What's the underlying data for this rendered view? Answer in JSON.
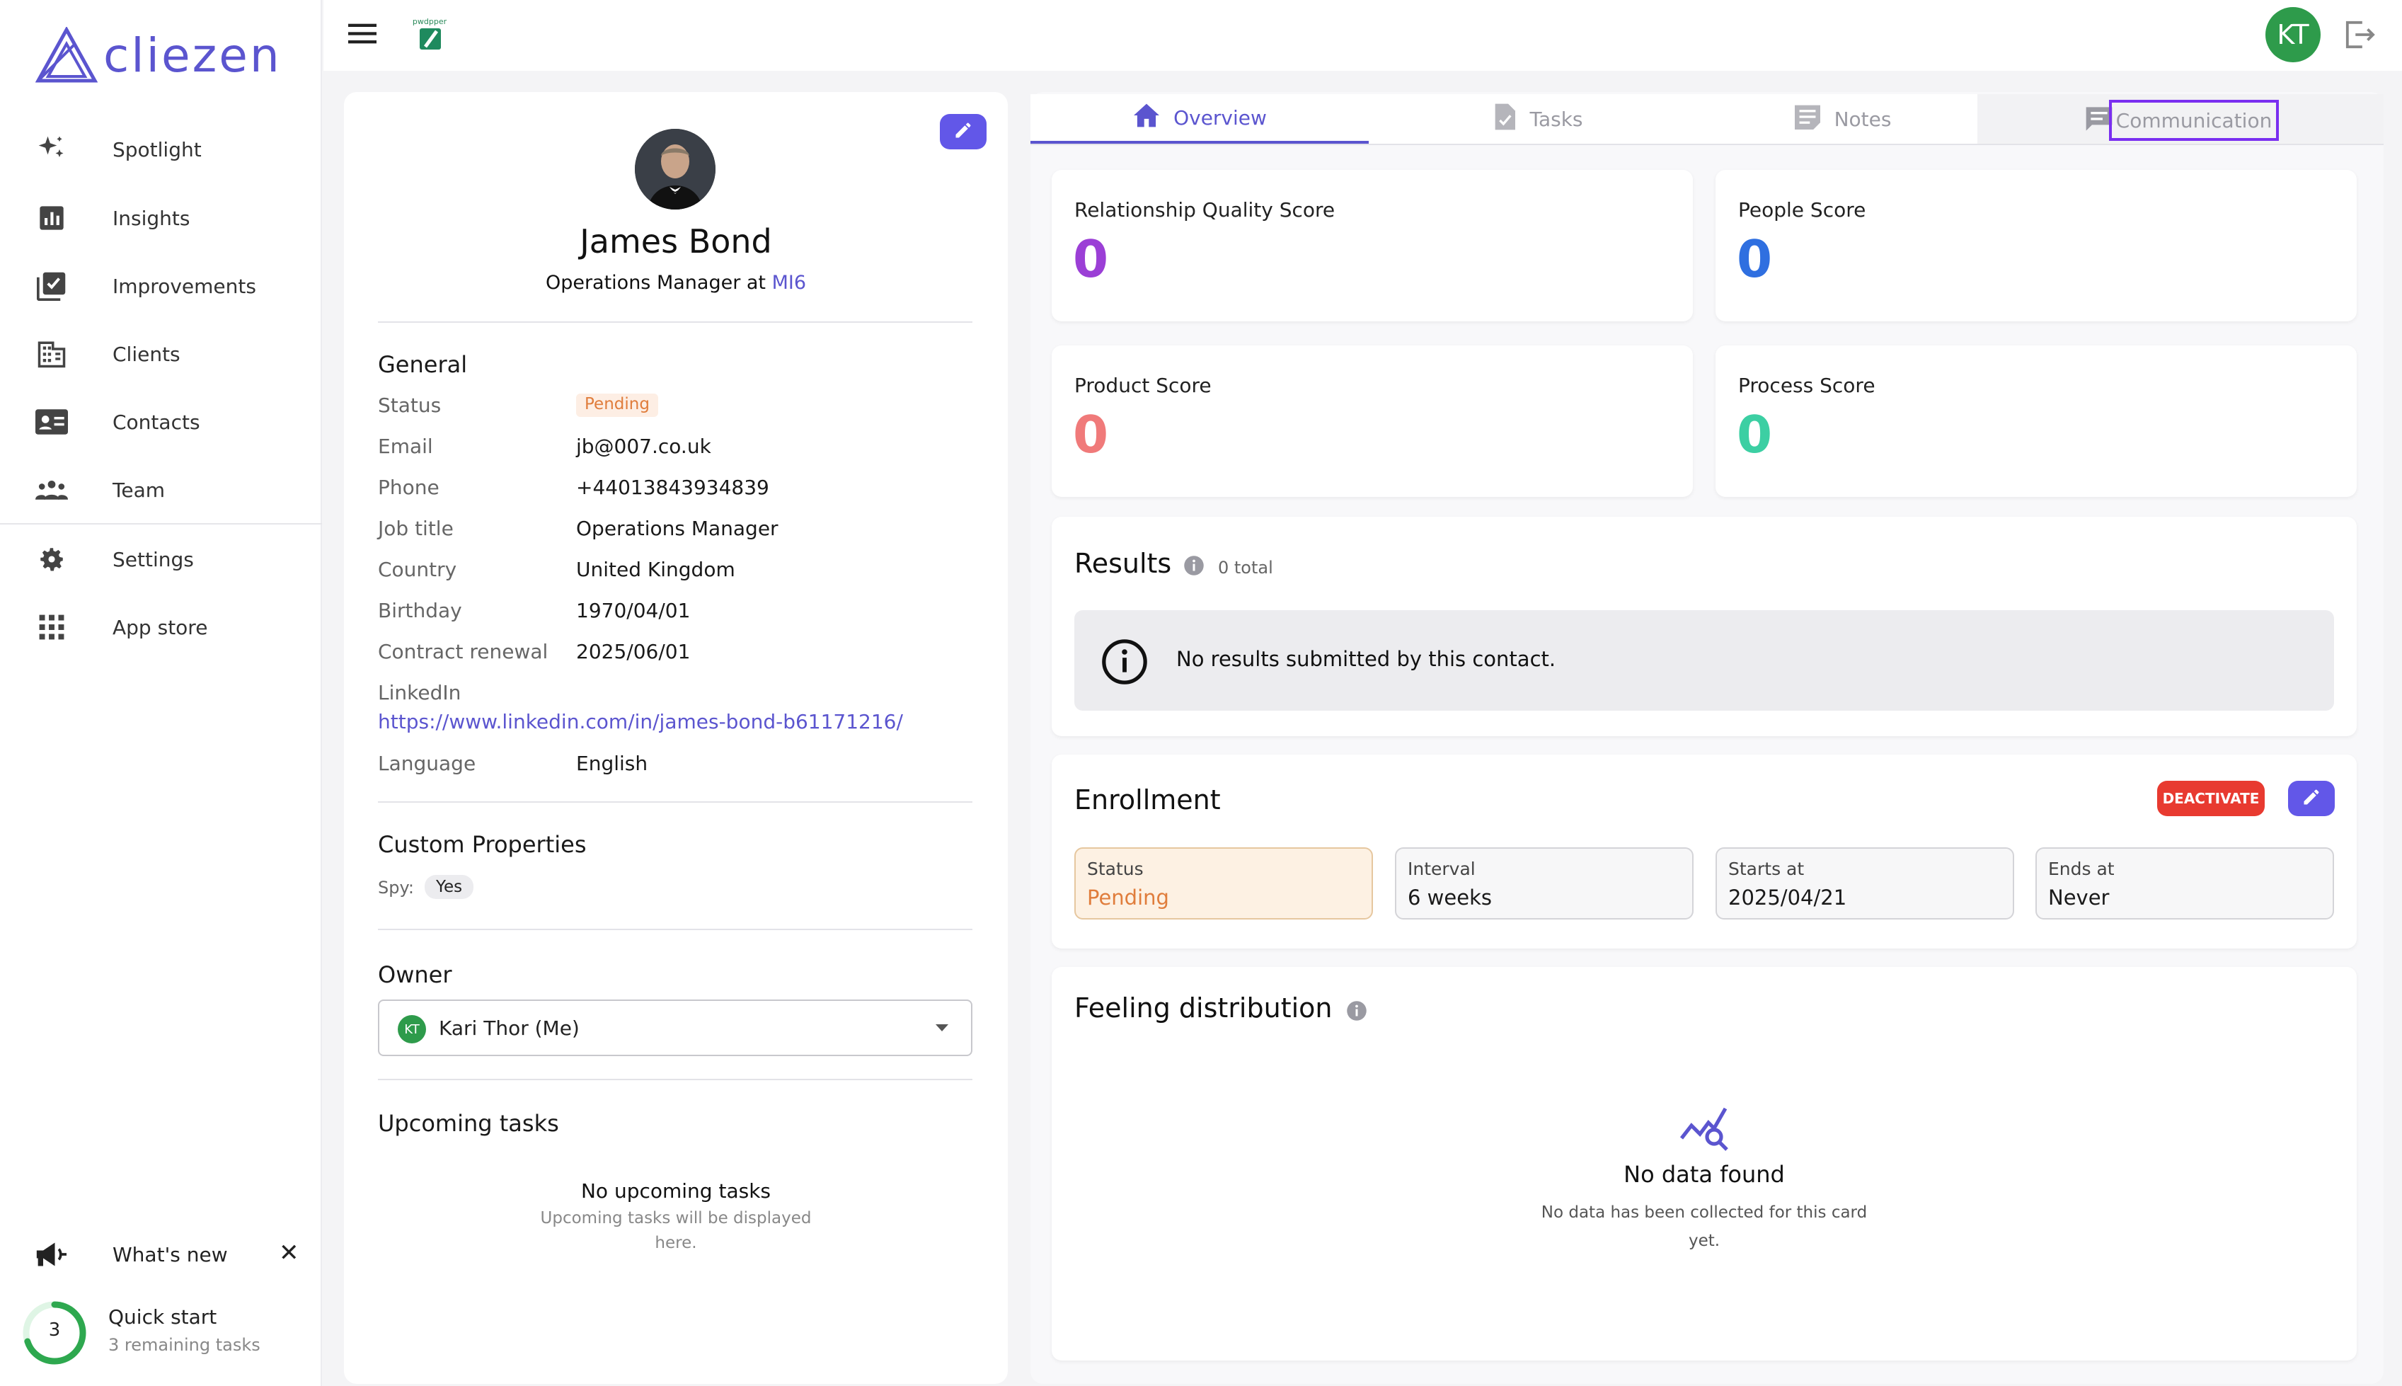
{
  "brand": {
    "name": "cliezen",
    "accent": "#5b55cf",
    "partner_label": "pwdpper"
  },
  "sidebar": {
    "items": [
      {
        "label": "Spotlight",
        "icon": "sparkle-icon"
      },
      {
        "label": "Insights",
        "icon": "chart-icon"
      },
      {
        "label": "Improvements",
        "icon": "checklist-icon"
      },
      {
        "label": "Clients",
        "icon": "building-icon"
      },
      {
        "label": "Contacts",
        "icon": "contact-card-icon"
      },
      {
        "label": "Team",
        "icon": "team-icon"
      },
      {
        "label": "Settings",
        "icon": "gear-icon"
      },
      {
        "label": "App store",
        "icon": "grid-icon"
      }
    ],
    "whats_new": "What's new",
    "quick_start": {
      "title": "Quick start",
      "subtitle": "3 remaining tasks",
      "count": "3",
      "progress": 0.7
    }
  },
  "topbar": {
    "user_initials": "KT",
    "avatar_color": "#2e9b4b"
  },
  "profile": {
    "name": "James Bond",
    "role_prefix": "Operations Manager at ",
    "company": "MI6",
    "general_title": "General",
    "fields": [
      {
        "key": "Status",
        "value": "Pending"
      },
      {
        "key": "Email",
        "value": "jb@007.co.uk"
      },
      {
        "key": "Phone",
        "value": "+44013843934839"
      },
      {
        "key": "Job title",
        "value": "Operations Manager"
      },
      {
        "key": "Country",
        "value": "United Kingdom"
      },
      {
        "key": "Birthday",
        "value": "1970/04/01"
      },
      {
        "key": "Contract renewal",
        "value": "2025/06/01"
      }
    ],
    "linkedin_label": "LinkedIn",
    "linkedin_url": "https://www.linkedin.com/in/james-bond-b61171216/",
    "language_label": "Language",
    "language": "English",
    "custom_title": "Custom Properties",
    "custom_key": "Spy:",
    "custom_value": "Yes",
    "owner_title": "Owner",
    "owner_initials": "KT",
    "owner_name": "Kari Thor (Me)",
    "tasks_title": "Upcoming tasks",
    "tasks_empty_title": "No upcoming tasks",
    "tasks_empty_line1": "Upcoming tasks will be displayed",
    "tasks_empty_line2": "here."
  },
  "tabs": [
    {
      "label": "Overview",
      "icon": "home-icon",
      "active": true
    },
    {
      "label": "Tasks",
      "icon": "task-doc-icon"
    },
    {
      "label": "Notes",
      "icon": "notes-icon"
    },
    {
      "label": "Communication",
      "icon": "chat-icon"
    }
  ],
  "scores": [
    {
      "label": "Relationship Quality Score",
      "value": "0",
      "color": "#9b3fd6"
    },
    {
      "label": "People Score",
      "value": "0",
      "color": "#2f6fe0"
    },
    {
      "label": "Product Score",
      "value": "0",
      "color": "#f07a7a"
    },
    {
      "label": "Process Score",
      "value": "0",
      "color": "#3ccfa3"
    }
  ],
  "results": {
    "title": "Results",
    "count": "0 total",
    "empty": "No results submitted by this contact."
  },
  "enrollment": {
    "title": "Enrollment",
    "deactivate": "DEACTIVATE",
    "boxes": [
      {
        "label": "Status",
        "value": "Pending"
      },
      {
        "label": "Interval",
        "value": "6 weeks"
      },
      {
        "label": "Starts at",
        "value": "2025/04/21"
      },
      {
        "label": "Ends at",
        "value": "Never"
      }
    ]
  },
  "feeling": {
    "title": "Feeling distribution",
    "empty_title": "No data found",
    "empty_line1": "No data has been collected for this card",
    "empty_line2": "yet."
  }
}
